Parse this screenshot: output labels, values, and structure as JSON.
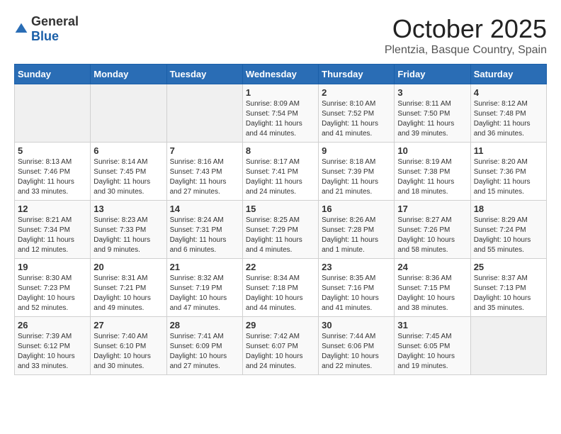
{
  "header": {
    "logo_general": "General",
    "logo_blue": "Blue",
    "month": "October 2025",
    "location": "Plentzia, Basque Country, Spain"
  },
  "weekdays": [
    "Sunday",
    "Monday",
    "Tuesday",
    "Wednesday",
    "Thursday",
    "Friday",
    "Saturday"
  ],
  "weeks": [
    [
      {
        "day": "",
        "info": ""
      },
      {
        "day": "",
        "info": ""
      },
      {
        "day": "",
        "info": ""
      },
      {
        "day": "1",
        "info": "Sunrise: 8:09 AM\nSunset: 7:54 PM\nDaylight: 11 hours\nand 44 minutes."
      },
      {
        "day": "2",
        "info": "Sunrise: 8:10 AM\nSunset: 7:52 PM\nDaylight: 11 hours\nand 41 minutes."
      },
      {
        "day": "3",
        "info": "Sunrise: 8:11 AM\nSunset: 7:50 PM\nDaylight: 11 hours\nand 39 minutes."
      },
      {
        "day": "4",
        "info": "Sunrise: 8:12 AM\nSunset: 7:48 PM\nDaylight: 11 hours\nand 36 minutes."
      }
    ],
    [
      {
        "day": "5",
        "info": "Sunrise: 8:13 AM\nSunset: 7:46 PM\nDaylight: 11 hours\nand 33 minutes."
      },
      {
        "day": "6",
        "info": "Sunrise: 8:14 AM\nSunset: 7:45 PM\nDaylight: 11 hours\nand 30 minutes."
      },
      {
        "day": "7",
        "info": "Sunrise: 8:16 AM\nSunset: 7:43 PM\nDaylight: 11 hours\nand 27 minutes."
      },
      {
        "day": "8",
        "info": "Sunrise: 8:17 AM\nSunset: 7:41 PM\nDaylight: 11 hours\nand 24 minutes."
      },
      {
        "day": "9",
        "info": "Sunrise: 8:18 AM\nSunset: 7:39 PM\nDaylight: 11 hours\nand 21 minutes."
      },
      {
        "day": "10",
        "info": "Sunrise: 8:19 AM\nSunset: 7:38 PM\nDaylight: 11 hours\nand 18 minutes."
      },
      {
        "day": "11",
        "info": "Sunrise: 8:20 AM\nSunset: 7:36 PM\nDaylight: 11 hours\nand 15 minutes."
      }
    ],
    [
      {
        "day": "12",
        "info": "Sunrise: 8:21 AM\nSunset: 7:34 PM\nDaylight: 11 hours\nand 12 minutes."
      },
      {
        "day": "13",
        "info": "Sunrise: 8:23 AM\nSunset: 7:33 PM\nDaylight: 11 hours\nand 9 minutes."
      },
      {
        "day": "14",
        "info": "Sunrise: 8:24 AM\nSunset: 7:31 PM\nDaylight: 11 hours\nand 6 minutes."
      },
      {
        "day": "15",
        "info": "Sunrise: 8:25 AM\nSunset: 7:29 PM\nDaylight: 11 hours\nand 4 minutes."
      },
      {
        "day": "16",
        "info": "Sunrise: 8:26 AM\nSunset: 7:28 PM\nDaylight: 11 hours\nand 1 minute."
      },
      {
        "day": "17",
        "info": "Sunrise: 8:27 AM\nSunset: 7:26 PM\nDaylight: 10 hours\nand 58 minutes."
      },
      {
        "day": "18",
        "info": "Sunrise: 8:29 AM\nSunset: 7:24 PM\nDaylight: 10 hours\nand 55 minutes."
      }
    ],
    [
      {
        "day": "19",
        "info": "Sunrise: 8:30 AM\nSunset: 7:23 PM\nDaylight: 10 hours\nand 52 minutes."
      },
      {
        "day": "20",
        "info": "Sunrise: 8:31 AM\nSunset: 7:21 PM\nDaylight: 10 hours\nand 49 minutes."
      },
      {
        "day": "21",
        "info": "Sunrise: 8:32 AM\nSunset: 7:19 PM\nDaylight: 10 hours\nand 47 minutes."
      },
      {
        "day": "22",
        "info": "Sunrise: 8:34 AM\nSunset: 7:18 PM\nDaylight: 10 hours\nand 44 minutes."
      },
      {
        "day": "23",
        "info": "Sunrise: 8:35 AM\nSunset: 7:16 PM\nDaylight: 10 hours\nand 41 minutes."
      },
      {
        "day": "24",
        "info": "Sunrise: 8:36 AM\nSunset: 7:15 PM\nDaylight: 10 hours\nand 38 minutes."
      },
      {
        "day": "25",
        "info": "Sunrise: 8:37 AM\nSunset: 7:13 PM\nDaylight: 10 hours\nand 35 minutes."
      }
    ],
    [
      {
        "day": "26",
        "info": "Sunrise: 7:39 AM\nSunset: 6:12 PM\nDaylight: 10 hours\nand 33 minutes."
      },
      {
        "day": "27",
        "info": "Sunrise: 7:40 AM\nSunset: 6:10 PM\nDaylight: 10 hours\nand 30 minutes."
      },
      {
        "day": "28",
        "info": "Sunrise: 7:41 AM\nSunset: 6:09 PM\nDaylight: 10 hours\nand 27 minutes."
      },
      {
        "day": "29",
        "info": "Sunrise: 7:42 AM\nSunset: 6:07 PM\nDaylight: 10 hours\nand 24 minutes."
      },
      {
        "day": "30",
        "info": "Sunrise: 7:44 AM\nSunset: 6:06 PM\nDaylight: 10 hours\nand 22 minutes."
      },
      {
        "day": "31",
        "info": "Sunrise: 7:45 AM\nSunset: 6:05 PM\nDaylight: 10 hours\nand 19 minutes."
      },
      {
        "day": "",
        "info": ""
      }
    ]
  ]
}
